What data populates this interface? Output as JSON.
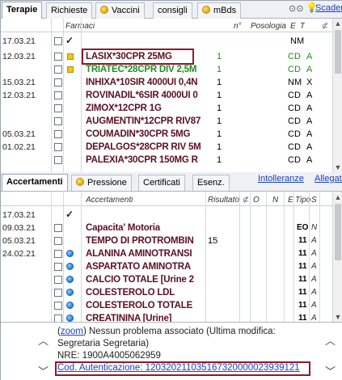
{
  "top_tabs": {
    "terapie": "Terapie",
    "richieste": "Richieste",
    "vaccini": "Vaccini",
    "consigli": "consigli",
    "mbds": "mBds",
    "scadenze": "Scadenze"
  },
  "therapy_header": {
    "farmaci": "Farmaci",
    "n": "n°",
    "posologia": "Posologia",
    "e": "E",
    "t": "T"
  },
  "therapy_rows": [
    {
      "date": "17.03.21",
      "check": "✓",
      "drug": "",
      "n": "",
      "e": "NM",
      "t": ""
    },
    {
      "date": "12.03.21",
      "drug": "LASIX*30CPR 25MG",
      "n": "1",
      "e": "CD",
      "t": "A",
      "green": false
    },
    {
      "date": "",
      "drug": "TRIATEC*28CPR DIV 2,5M",
      "n": "1",
      "e": "CD",
      "t": "A",
      "green": true
    },
    {
      "date": "15.03.21",
      "drug": "INHIXA*10SIR 4000UI 0,4N",
      "n": "1",
      "e": "NM",
      "t": "X",
      "green": false
    },
    {
      "date": "12.03.21",
      "drug": "ROVINADIL*6SIR 4000UI 0",
      "n": "1",
      "e": "CD",
      "t": "A",
      "green": false
    },
    {
      "date": "",
      "drug": "ZIMOX*12CPR 1G",
      "n": "1",
      "e": "CD",
      "t": "A",
      "green": false
    },
    {
      "date": "",
      "drug": "AUGMENTIN*12CPR RIV87",
      "n": "1",
      "e": "CD",
      "t": "A",
      "green": false
    },
    {
      "date": "05.03.21",
      "drug": "COUMADIN*30CPR 5MG",
      "n": "1",
      "e": "CD",
      "t": "A",
      "green": false
    },
    {
      "date": "01.02.21",
      "drug": "DEPALGOS*28CPR RIV 5M",
      "n": "1",
      "e": "CD",
      "t": "A",
      "green": false
    },
    {
      "date": "",
      "drug": "PALEXIA*30CPR 150MG R",
      "n": "1",
      "e": "CD",
      "t": "A",
      "green": false
    }
  ],
  "exam_tabs": {
    "accertamenti": "Accertamenti",
    "pressione": "Pressione",
    "certificati": "Certificati",
    "esenz": "Esenz.",
    "intolleranze": "Intolleranze",
    "allegati": "Allegati"
  },
  "exam_header": {
    "accertamenti": "Accertamenti",
    "risultato": "Risultato",
    "o": "O",
    "n": "N",
    "e": "E",
    "tipo": "Tipo",
    "s": "S"
  },
  "exam_rows": [
    {
      "date": "17.03.21",
      "check": "✓",
      "name": "",
      "result": "",
      "tipo": "",
      "s": ""
    },
    {
      "date": "09.03.21",
      "name": "Capacita' Motoria",
      "result": "",
      "tipo": "EO",
      "s": "N",
      "ball": false
    },
    {
      "date": "05.03.21",
      "name": "TEMPO DI PROTROMBIN",
      "result": "15",
      "tipo": "11",
      "s": "A",
      "ball": false
    },
    {
      "date": "24.02.21",
      "name": "ALANINA AMINOTRANSI",
      "result": "",
      "tipo": "11",
      "s": "A",
      "ball": true
    },
    {
      "date": "",
      "name": "ASPARTATO AMINOTRA",
      "result": "",
      "tipo": "11",
      "s": "A",
      "ball": true
    },
    {
      "date": "",
      "name": "CALCIO TOTALE [Urine 2",
      "result": "",
      "tipo": "11",
      "s": "A",
      "ball": true
    },
    {
      "date": "",
      "name": "COLESTEROLO LDL",
      "result": "",
      "tipo": "11",
      "s": "A",
      "ball": true
    },
    {
      "date": "",
      "name": "COLESTEROLO TOTALE",
      "result": "",
      "tipo": "11",
      "s": "A",
      "ball": true
    },
    {
      "date": "",
      "name": "CREATININA [Urine]",
      "result": "",
      "tipo": "11",
      "s": "A",
      "ball": true
    }
  ],
  "note": {
    "zoom": "zoom",
    "line1": ") Nessun problema associato (Ultima modifica: Segretaria Segretaria)",
    "line2": "NRE: 1900A4005062959",
    "auth": "Cod. Autenticazione: 120320211035167320000023939121"
  }
}
